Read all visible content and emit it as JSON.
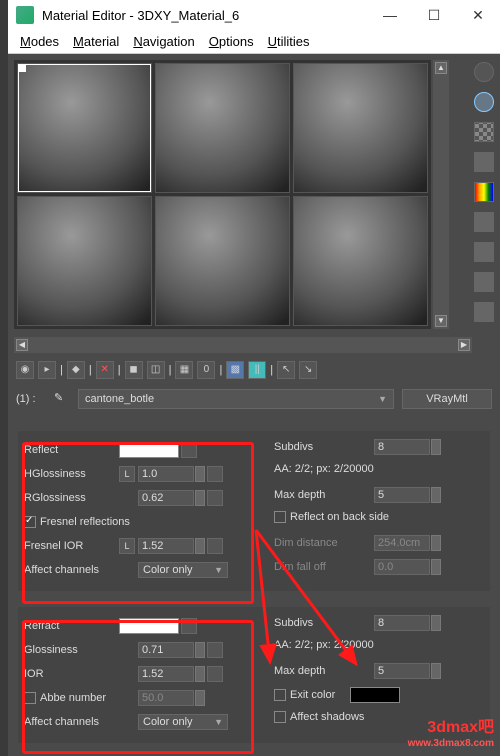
{
  "window": {
    "title": "Material Editor - 3DXY_Material_6",
    "btn_min": "—",
    "btn_max": "☐",
    "btn_close": "✕"
  },
  "menu": {
    "modes": "Modes",
    "material": "Material",
    "navigation": "Navigation",
    "options": "Options",
    "utilities": "Utilities"
  },
  "name_row": {
    "index": "(1) :",
    "name": "cantone_botle",
    "type": "VRayMtl"
  },
  "reflect": {
    "label": "Reflect",
    "hgloss_label": "HGlossiness",
    "hgloss_value": "1.0",
    "rgloss_label": "RGlossiness",
    "rgloss_value": "0.62",
    "fresnel_label": "Fresnel reflections",
    "fresnel_ior_label": "Fresnel IOR",
    "fresnel_ior_value": "1.52",
    "affect_label": "Affect channels",
    "affect_value": "Color only",
    "subdivs_label": "Subdivs",
    "subdivs_value": "8",
    "aa_label": "AA: 2/2; px: 2/20000",
    "maxdepth_label": "Max depth",
    "maxdepth_value": "5",
    "backside_label": "Reflect on back side",
    "dimdist_label": "Dim distance",
    "dimdist_value": "254.0cm",
    "dimfall_label": "Dim fall off",
    "dimfall_value": "0.0"
  },
  "refract": {
    "label": "Refract",
    "gloss_label": "Glossiness",
    "gloss_value": "0.71",
    "ior_label": "IOR",
    "ior_value": "1.52",
    "abbe_label": "Abbe number",
    "abbe_value": "50.0",
    "affect_label": "Affect channels",
    "affect_value": "Color only",
    "subdivs_label": "Subdivs",
    "subdivs_value": "8",
    "aa_label": "AA: 2/2; px: 2/20000",
    "maxdepth_label": "Max depth",
    "maxdepth_value": "5",
    "exit_label": "Exit color",
    "shadows_label": "Affect shadows"
  },
  "watermark": {
    "main": "3dmax吧",
    "sub": "www.3dmax8.com"
  },
  "toolbar_sep": "|",
  "lbtn": "L"
}
